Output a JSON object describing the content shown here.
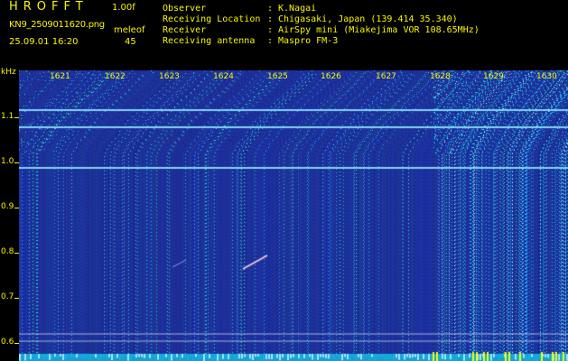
{
  "header": {
    "app_name": "HROFFT",
    "version": "1.00f",
    "filename": "KN9_2509011620.png",
    "mode_label": "meleof",
    "datetime": "25.09.01 16:20",
    "mode_value": "45"
  },
  "info": [
    {
      "label": "Observer",
      "value": "K.Nagai"
    },
    {
      "label": "Receiving Location",
      "value": "Chigasaki, Japan (139.414 35.340)"
    },
    {
      "label": "Receiver",
      "value": "AirSpy mini (Miakejima VOR 108.65MHz)"
    },
    {
      "label": "Receiving antenna",
      "value": "Maspro FM-3"
    }
  ],
  "spectrogram": {
    "y_unit": "kHz",
    "y_labels": [
      "1.1",
      "1.0",
      "0.9",
      "0.8",
      "0.7",
      "0.6"
    ],
    "x_labels": [
      "1621",
      "1622",
      "1623",
      "1624",
      "1625",
      "1626",
      "1627",
      "1628",
      "1629",
      "1630"
    ],
    "colors": {
      "background": "#1a2a9c",
      "text": "#f7f700",
      "signal": "#7fe4ff"
    }
  }
}
